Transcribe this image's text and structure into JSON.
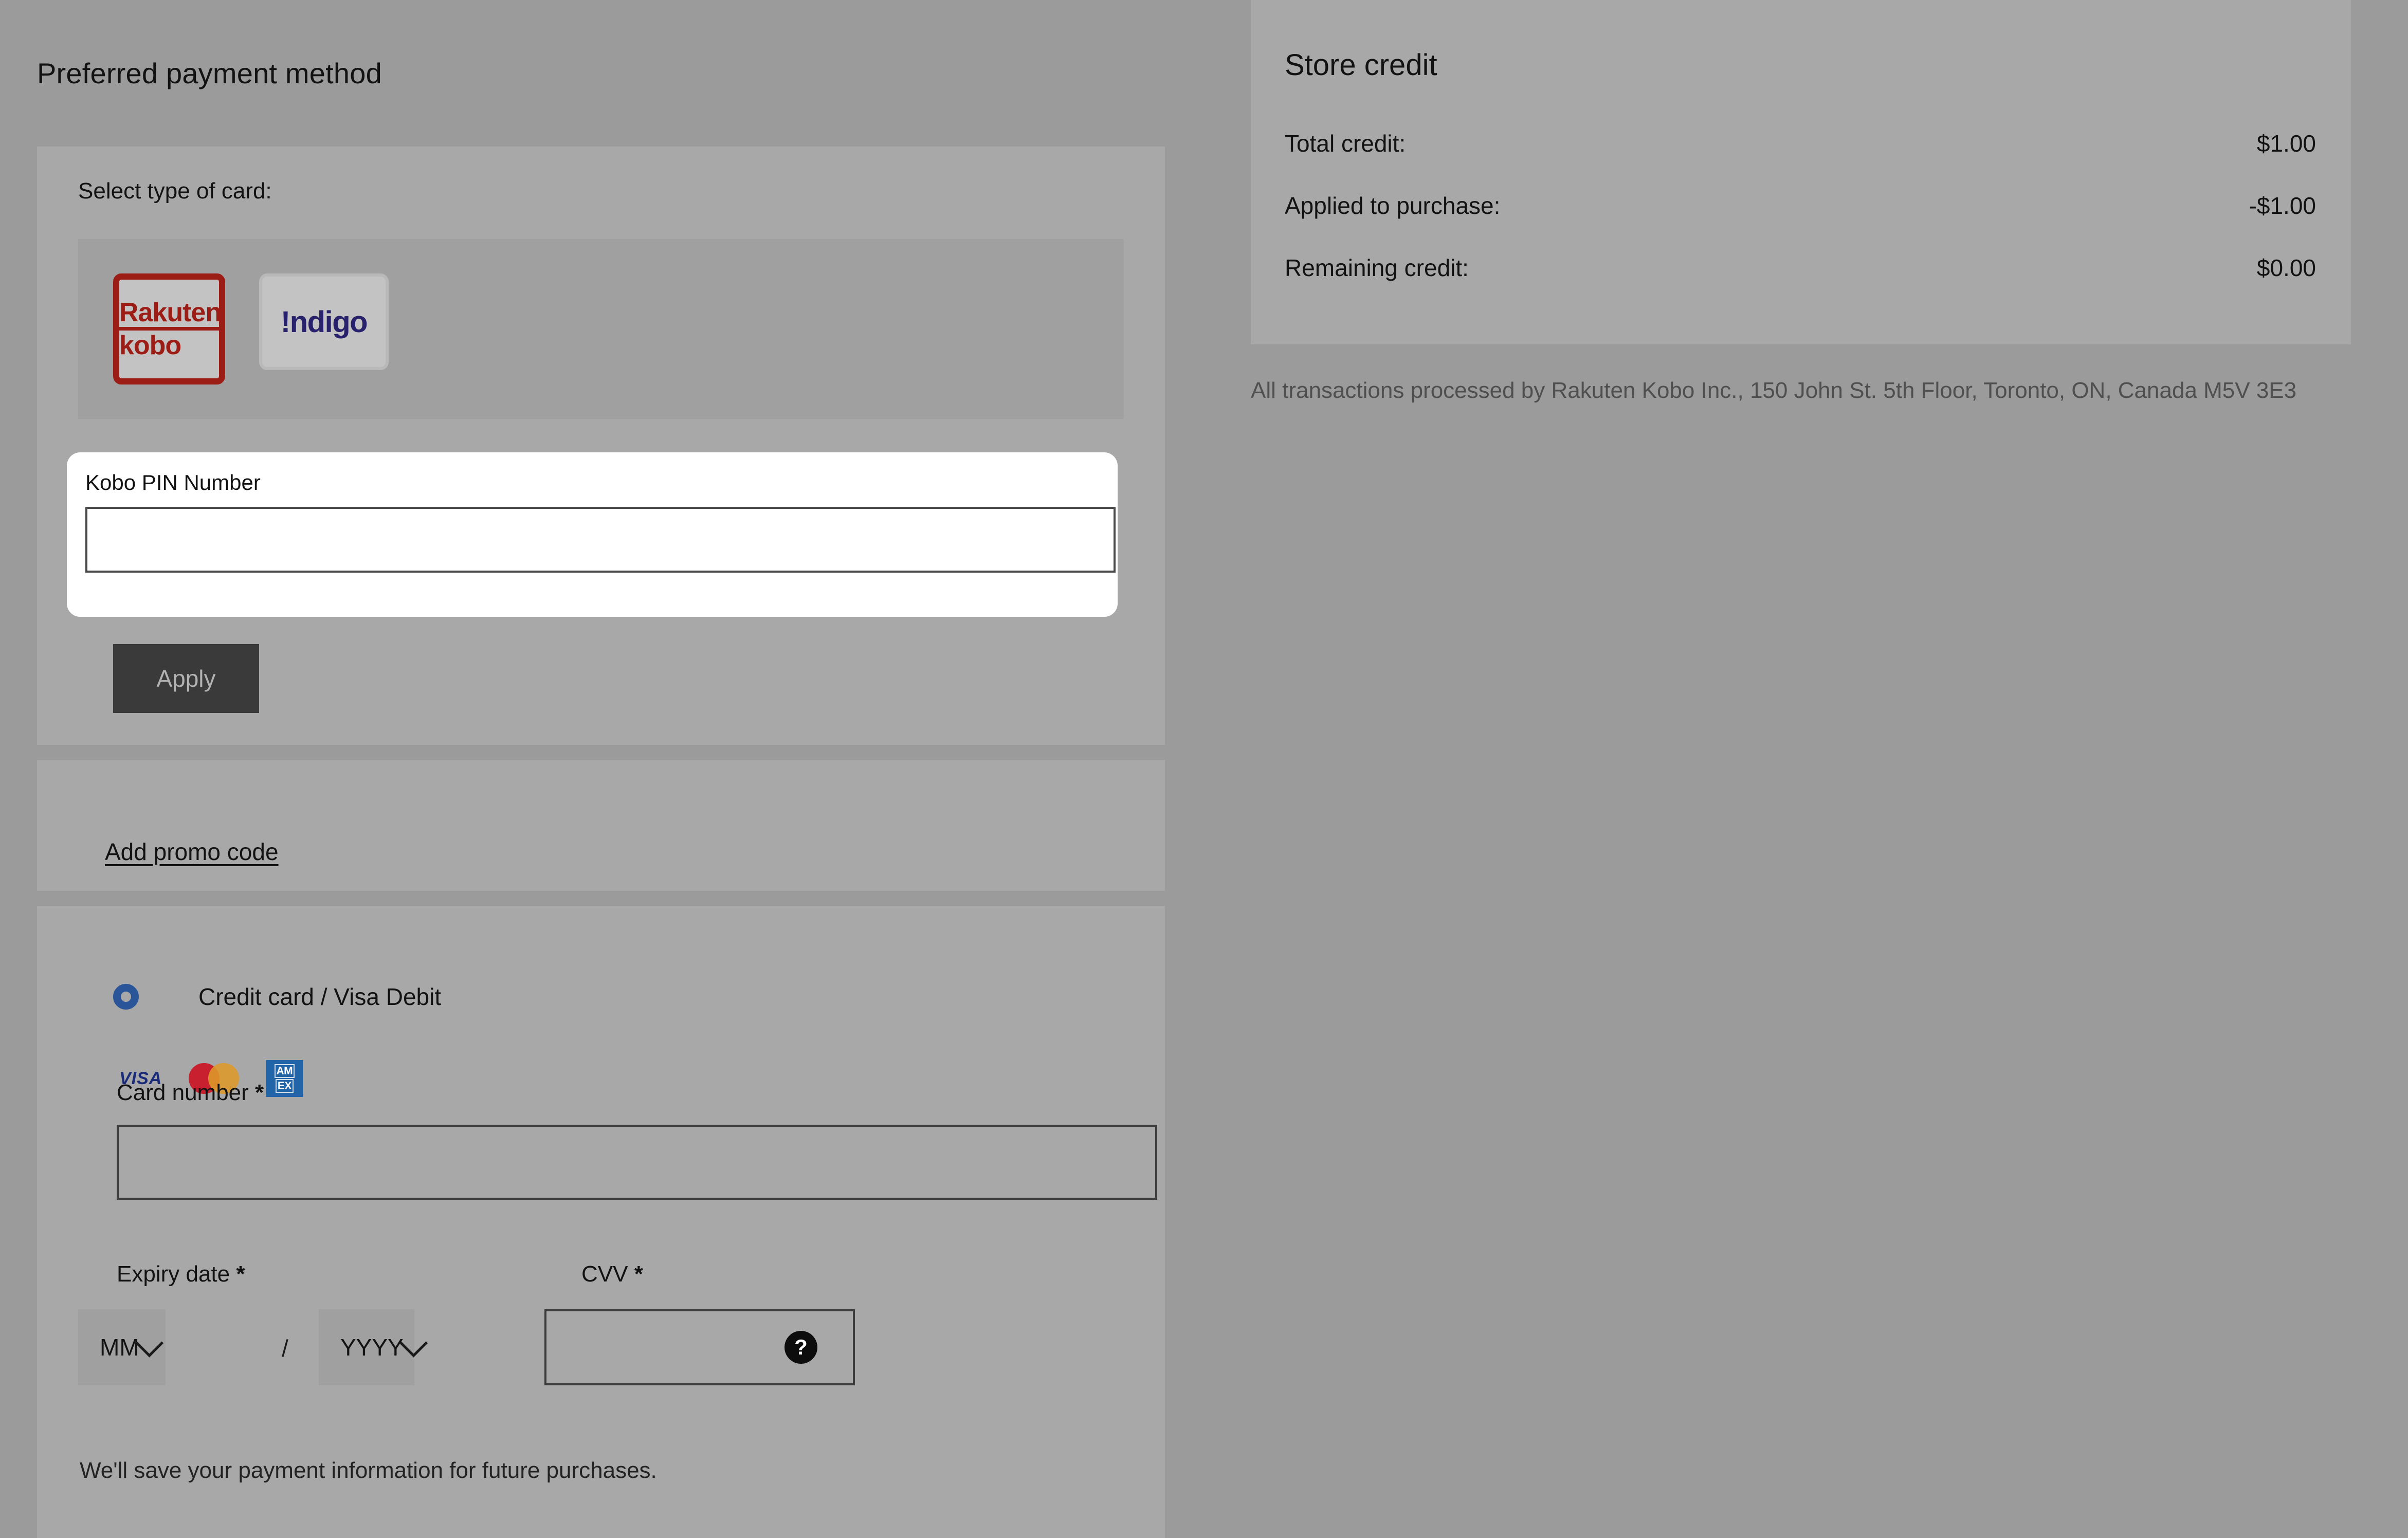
{
  "page": {
    "title": "Preferred payment method"
  },
  "card_type_section": {
    "label": "Select type of card:",
    "options": [
      {
        "name": "rakuten-kobo",
        "line1": "Rakuten",
        "line2": "kobo",
        "selected": true
      },
      {
        "name": "indigo",
        "wordmark": "!ndigo",
        "selected": false
      }
    ],
    "pin": {
      "label": "Kobo PIN Number",
      "value": "",
      "placeholder": ""
    },
    "apply_label": "Apply"
  },
  "promo_section": {
    "link_label": "Add promo code"
  },
  "credit_card_section": {
    "radio_label": "Credit card / Visa Debit",
    "accepted_brands": [
      "VISA",
      "Mastercard",
      "AMEX"
    ],
    "card_number": {
      "label": "Card number",
      "required_marker": "*",
      "value": "",
      "placeholder": ""
    },
    "expiry": {
      "label": "Expiry date",
      "required_marker": "*",
      "month_value": "MM",
      "year_value": "YYYY",
      "separator": "/"
    },
    "cvv": {
      "label": "CVV",
      "required_marker": "*",
      "value": "",
      "placeholder": "",
      "help_glyph": "?"
    },
    "save_note": "We'll save your payment information for future purchases."
  },
  "store_credit": {
    "title": "Store credit",
    "rows": [
      {
        "key": "Total credit:",
        "value": "$1.00"
      },
      {
        "key": "Applied to purchase:",
        "value": "-$1.00"
      },
      {
        "key": "Remaining credit:",
        "value": "$0.00"
      }
    ]
  },
  "legal": {
    "text": "All transactions processed by Rakuten Kobo Inc., 150 John St. 5th Floor, Toronto, ON, Canada M5V 3E3"
  },
  "colors": {
    "page_background": "#9b9b9b",
    "card_background": "#a8a8a8",
    "kobo_red": "#9c1d16",
    "indigo_navy": "#27226b",
    "radio_blue": "#2a5699",
    "apply_button": "#3a3a3a",
    "visa_blue": "#1a2a7a",
    "mastercard_red": "#c8202e",
    "mastercard_gold": "#dd9a29",
    "amex_blue": "#2264a8"
  }
}
